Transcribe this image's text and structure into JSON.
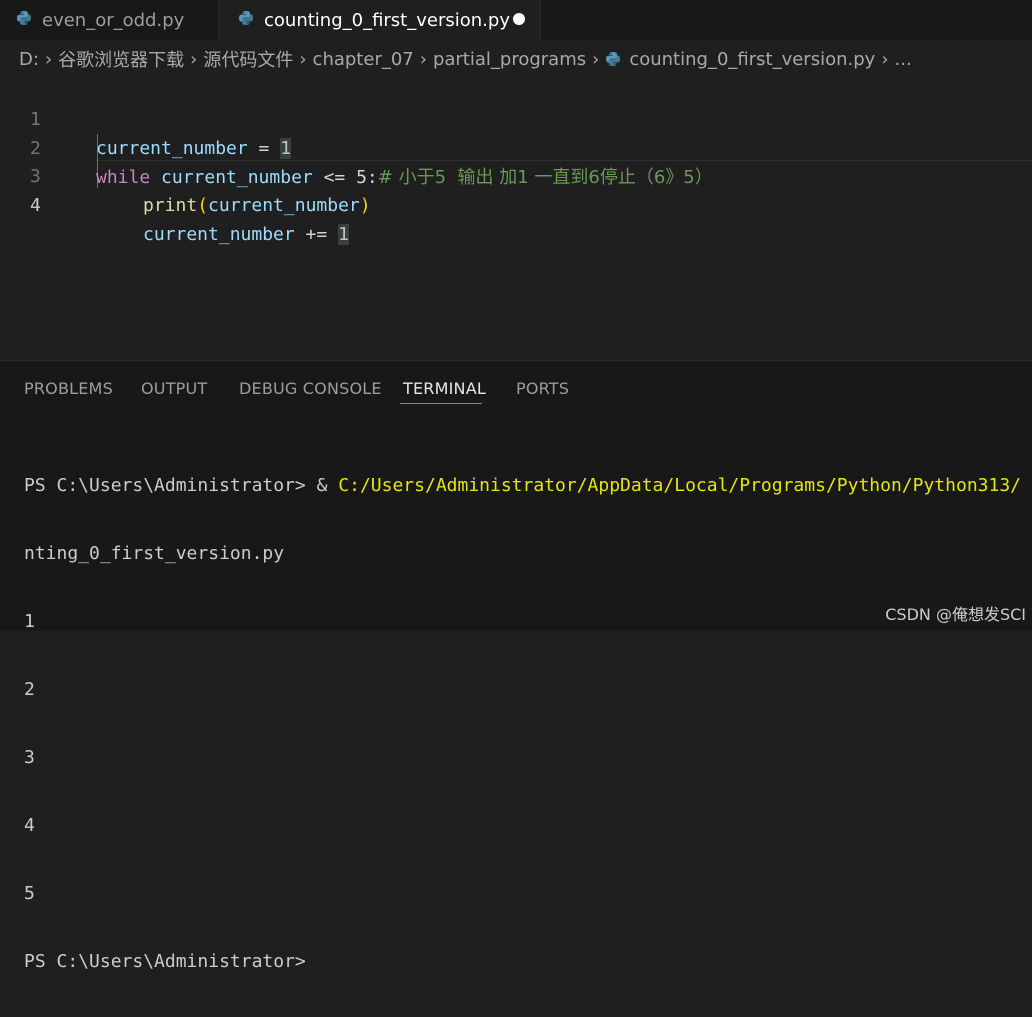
{
  "tabs": [
    {
      "label": "even_or_odd.py",
      "active": false
    },
    {
      "label": "counting_0_first_version.py",
      "active": true,
      "unsaved": true
    }
  ],
  "breadcrumb": [
    "D:",
    "谷歌浏览器下载",
    "源代码文件",
    "chapter_07",
    "partial_programs",
    "counting_0_first_version.py",
    "..."
  ],
  "editor": {
    "lines": [
      {
        "number": "1"
      },
      {
        "number": "2"
      },
      {
        "number": "3"
      },
      {
        "number": "4"
      }
    ],
    "tokens": {
      "l1_var": "current_number",
      "l1_op": " = ",
      "l1_num": "1",
      "l2_kw": "while",
      "l2_var": " current_number",
      "l2_op": " <= 5:",
      "l2_comment": "# 小于5  输出 加1 一直到6停止（6》5）",
      "l3_fn": "print",
      "l3_open": "(",
      "l3_var": "current_number",
      "l3_close": ")",
      "l4_var": "current_number",
      "l4_op": " += ",
      "l4_num": "1"
    }
  },
  "panel": {
    "tabs": [
      "PROBLEMS",
      "OUTPUT",
      "DEBUG CONSOLE",
      "TERMINAL",
      "PORTS"
    ],
    "active_tab": "TERMINAL",
    "terminal": {
      "prompt_1": "PS C:\\Users\\Administrator> & ",
      "path_1": "C:/Users/Administrator/AppData/Local/Programs/Python/Python313/",
      "line_2": "nting_0_first_version.py",
      "outputs": [
        "1",
        "2",
        "3",
        "4",
        "5"
      ],
      "prompt_last": "PS C:\\Users\\Administrator>"
    }
  },
  "watermark": "CSDN @俺想发SCI",
  "icons": {
    "python": "python-file-icon",
    "unsaved": "unsaved-dot-icon"
  },
  "colors": {
    "accent": "#3794ff",
    "keyword": "#c586c0",
    "variable": "#9cdcfe",
    "number": "#b5cea8",
    "comment": "#6a9955",
    "path": "#e5e510"
  }
}
